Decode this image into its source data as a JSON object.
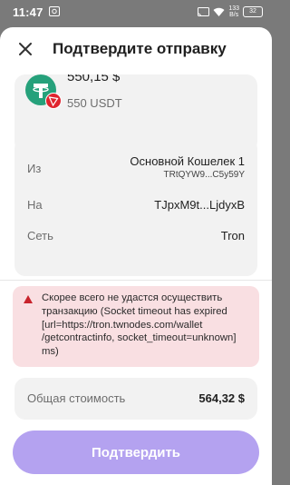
{
  "status_bar": {
    "time": "11:47",
    "net_speed_value": "133",
    "net_speed_unit": "B/s",
    "battery": "32"
  },
  "header": {
    "title": "Подтвердите отправку"
  },
  "asset": {
    "fiat_amount": "550,15 $",
    "token_amount": "550 USDT"
  },
  "details": {
    "from_label": "Из",
    "from_wallet": "Основной Кошелек 1",
    "from_address": "TRtQYW9...C5y59Y",
    "to_label": "На",
    "to_address": "TJpxM9t...LjdyxB",
    "network_label": "Сеть",
    "network_value": "Tron"
  },
  "warning": {
    "text": "Скорее всего не удастся осуществить транзакцию (Socket timeout has expired [url=https://tron.twnodes.com/wallet /getcontractinfo, socket_timeout=unknown] ms)"
  },
  "total": {
    "label": "Общая стоимость",
    "value": "564,32 $"
  },
  "confirm_label": "Подтвердить",
  "colors": {
    "accent": "#b4a2f0",
    "tether": "#26a17b",
    "tron": "#e0242e",
    "warning_bg": "#f9dfe2"
  }
}
